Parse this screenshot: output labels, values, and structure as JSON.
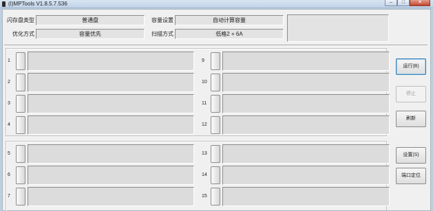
{
  "window": {
    "title": "(I)MPTools V1.8.5.7.536",
    "minimize_glyph": "–",
    "maximize_glyph": "□",
    "close_glyph": "✕"
  },
  "config": {
    "flash_type": {
      "label": "闪存盘类型",
      "value": "普通盘"
    },
    "capacity": {
      "label": "容量设置",
      "value": "自动计算容量"
    },
    "optimize": {
      "label": "优化方式",
      "value": "容量优先"
    },
    "scan": {
      "label": "扫描方式",
      "value": "低格2 + 6A"
    },
    "status_text": ""
  },
  "ports": {
    "left": [
      {
        "num": "1"
      },
      {
        "num": "2"
      },
      {
        "num": "3"
      },
      {
        "num": "4"
      },
      {
        "num": "5"
      },
      {
        "num": "6"
      },
      {
        "num": "7"
      }
    ],
    "right": [
      {
        "num": "9"
      },
      {
        "num": "10"
      },
      {
        "num": "11"
      },
      {
        "num": "12"
      },
      {
        "num": "13"
      },
      {
        "num": "14"
      },
      {
        "num": "15"
      }
    ]
  },
  "buttons": {
    "run": "运行(B)",
    "stop": "停止",
    "refresh": "刷新",
    "settings": "设置(S)",
    "port_locate": "端口定位"
  }
}
